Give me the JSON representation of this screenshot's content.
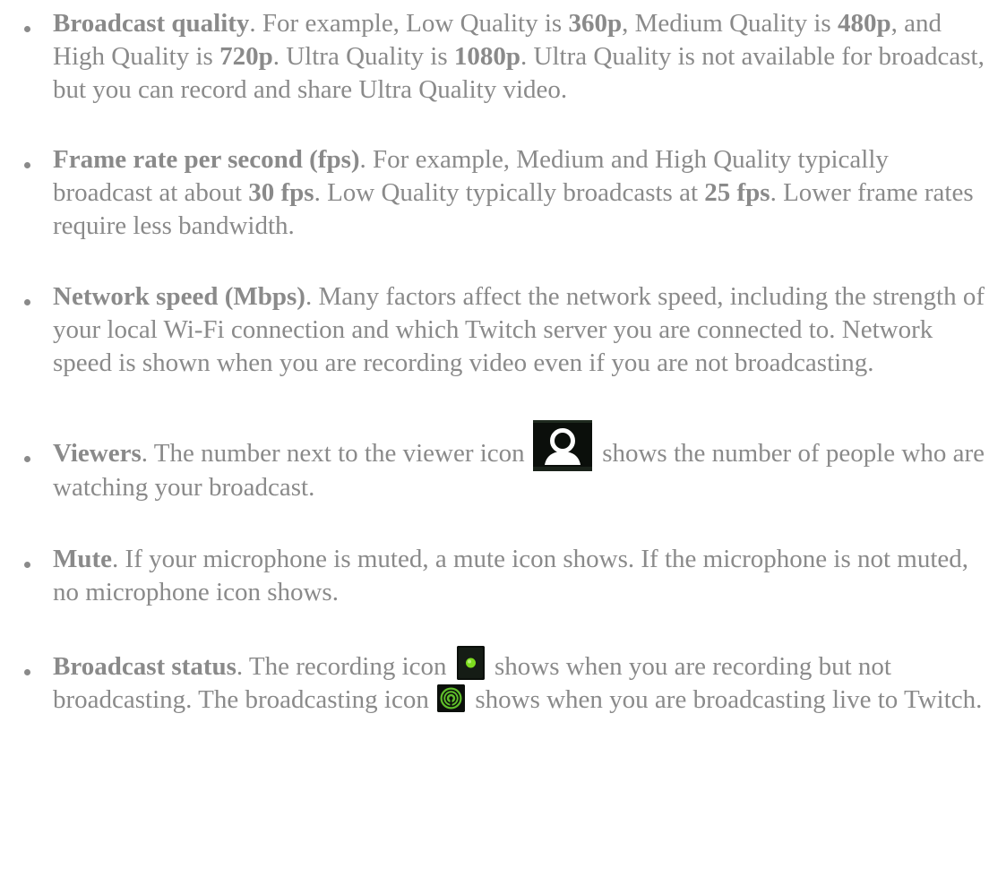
{
  "items": [
    {
      "title": "Broadcast quality",
      "t1": ". For example, Low Quality is ",
      "b1": "360p",
      "t2": ", Medium Quality is ",
      "b2": "480p",
      "t3": ", and High Quality is ",
      "b3": "720p",
      "t4": ". Ultra Quality is ",
      "b4": "1080p",
      "t5": ". Ultra Quality is not available for broadcast, but you can record and share Ultra Quality video."
    },
    {
      "title": "Frame rate per second (fps)",
      "t1": ". For example, Medium and High Quality typically broadcast at about ",
      "b1": "30 fps",
      "t2": ". Low Quality typically broadcasts at ",
      "b2": "25 fps",
      "t3": ". Lower frame rates require less bandwidth."
    },
    {
      "title": "Network speed (Mbps)",
      "t1": ". Many factors affect the network speed, including the strength of your local Wi-Fi connection and which Twitch server you are connected to. Network speed is shown when you are recording video even if you are not broadcasting."
    },
    {
      "title": "Viewers",
      "t1": ". The number next to the viewer icon ",
      "icon": "viewer-icon",
      "t2": " shows the number of people who are watching your broadcast."
    },
    {
      "title": "Mute",
      "t1": ". If your microphone is muted, a mute icon shows. If the microphone is not muted, no microphone icon shows."
    },
    {
      "title": "Broadcast status",
      "t1": ". The recording icon ",
      "icon1": "recording-icon",
      "t2": " shows when you are recording but not broadcasting. The broadcasting icon ",
      "icon2": "broadcasting-icon",
      "t3": " shows when you are broadcasting live to Twitch."
    }
  ],
  "colors": {
    "text": "#8a8a8a",
    "icon_bg": "#0b0f0b",
    "recording_green": "#7ddc1f",
    "broadcast_green": "#5fbf2a"
  }
}
